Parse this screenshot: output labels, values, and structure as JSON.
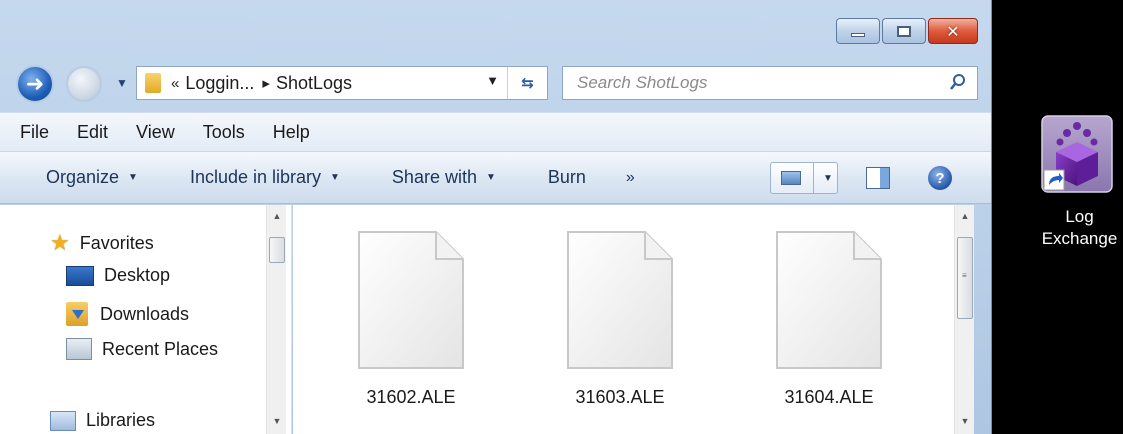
{
  "window": {
    "caption_buttons": {
      "minimize": "minimize",
      "maximize": "maximize",
      "close": "✕"
    }
  },
  "address_bar": {
    "overflow": "«",
    "crumbs": [
      "Loggin...",
      "ShotLogs"
    ],
    "separator": "▸",
    "dropdown_arrow": "▼",
    "refresh_glyph": "⇆"
  },
  "search": {
    "placeholder": "Search ShotLogs",
    "value": ""
  },
  "menu": [
    "File",
    "Edit",
    "View",
    "Tools",
    "Help"
  ],
  "command_bar": {
    "items": [
      "Organize",
      "Include in library",
      "Share with",
      "Burn"
    ],
    "overflow": "»",
    "help": "?"
  },
  "nav_pane": {
    "favorites": "Favorites",
    "items": [
      "Desktop",
      "Downloads",
      "Recent Places"
    ],
    "libraries": "Libraries"
  },
  "files": [
    {
      "name": "31602.ALE"
    },
    {
      "name": "31603.ALE"
    },
    {
      "name": "31604.ALE"
    }
  ],
  "desktop_shortcut": {
    "label": "Log\nExchange"
  },
  "colors": {
    "window_frame": "#b9cfe8",
    "close_button": "#dd5b3e",
    "desktop_bg": "#000000",
    "file_bg": "#ffffff"
  }
}
